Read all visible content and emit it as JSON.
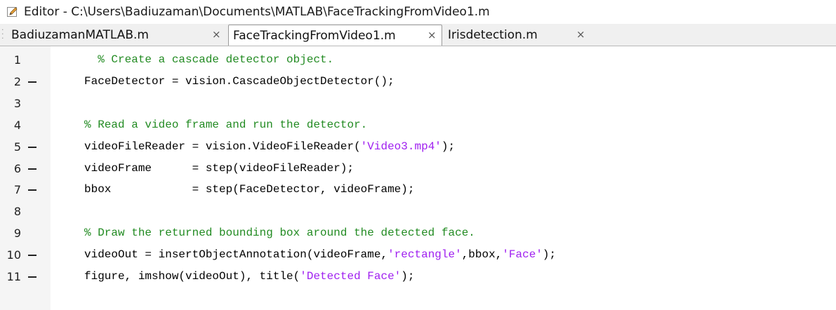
{
  "window": {
    "title": "Editor - C:\\Users\\Badiuzaman\\Documents\\MATLAB\\FaceTrackingFromVideo1.m",
    "icon": "editor-pencil-icon"
  },
  "tabs": [
    {
      "label": "BadiuzamanMATLAB.m",
      "close": "×",
      "active": false
    },
    {
      "label": "FaceTrackingFromVideo1.m",
      "close": "×",
      "active": true
    },
    {
      "label": "Irisdetection.m",
      "close": "×",
      "active": false
    }
  ],
  "editor": {
    "lines": [
      {
        "num": "1",
        "exec": false,
        "text": "  % Create a cascade detector object."
      },
      {
        "num": "2",
        "exec": true,
        "text": "FaceDetector = vision.CascadeObjectDetector();"
      },
      {
        "num": "3",
        "exec": false,
        "text": ""
      },
      {
        "num": "4",
        "exec": false,
        "text": "% Read a video frame and run the detector."
      },
      {
        "num": "5",
        "exec": true,
        "text": "videoFileReader = vision.VideoFileReader('Video3.mp4');"
      },
      {
        "num": "6",
        "exec": true,
        "text": "videoFrame      = step(videoFileReader);"
      },
      {
        "num": "7",
        "exec": true,
        "text": "bbox            = step(FaceDetector, videoFrame);"
      },
      {
        "num": "8",
        "exec": false,
        "text": ""
      },
      {
        "num": "9",
        "exec": false,
        "text": "% Draw the returned bounding box around the detected face."
      },
      {
        "num": "10",
        "exec": true,
        "text": "videoOut = insertObjectAnnotation(videoFrame,'rectangle',bbox,'Face');"
      },
      {
        "num": "11",
        "exec": true,
        "text": "figure, imshow(videoOut), title('Detected Face');"
      }
    ]
  },
  "colors": {
    "comment": "#228b22",
    "string": "#a020f0",
    "code": "#000000"
  }
}
